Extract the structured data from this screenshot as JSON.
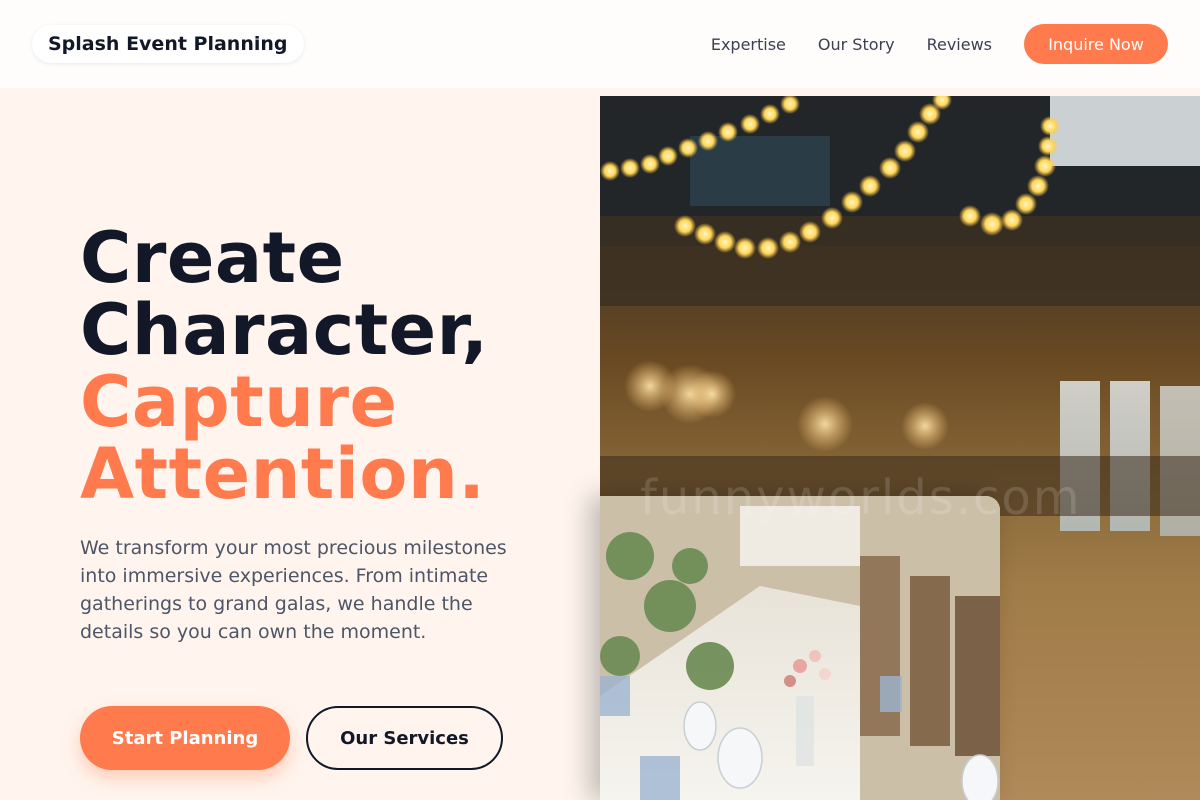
{
  "header": {
    "brand": "Splash Event Planning",
    "nav": [
      "Expertise",
      "Our Story",
      "Reviews"
    ],
    "cta": "Inquire Now"
  },
  "hero": {
    "headline_line1": "Create",
    "headline_line2": "Character,",
    "headline_accent1": "Capture",
    "headline_accent2": "Attention.",
    "lead": "We transform your most precious milestones into immersive experiences. From intimate gatherings to grand galas, we handle the details so you can own the moment.",
    "primary_button": "Start Planning",
    "secondary_button": "Our Services"
  },
  "watermark": "funnyworlds.com",
  "colors": {
    "accent": "#ff7a4d",
    "dark": "#121828",
    "background": "#fff5ee"
  }
}
